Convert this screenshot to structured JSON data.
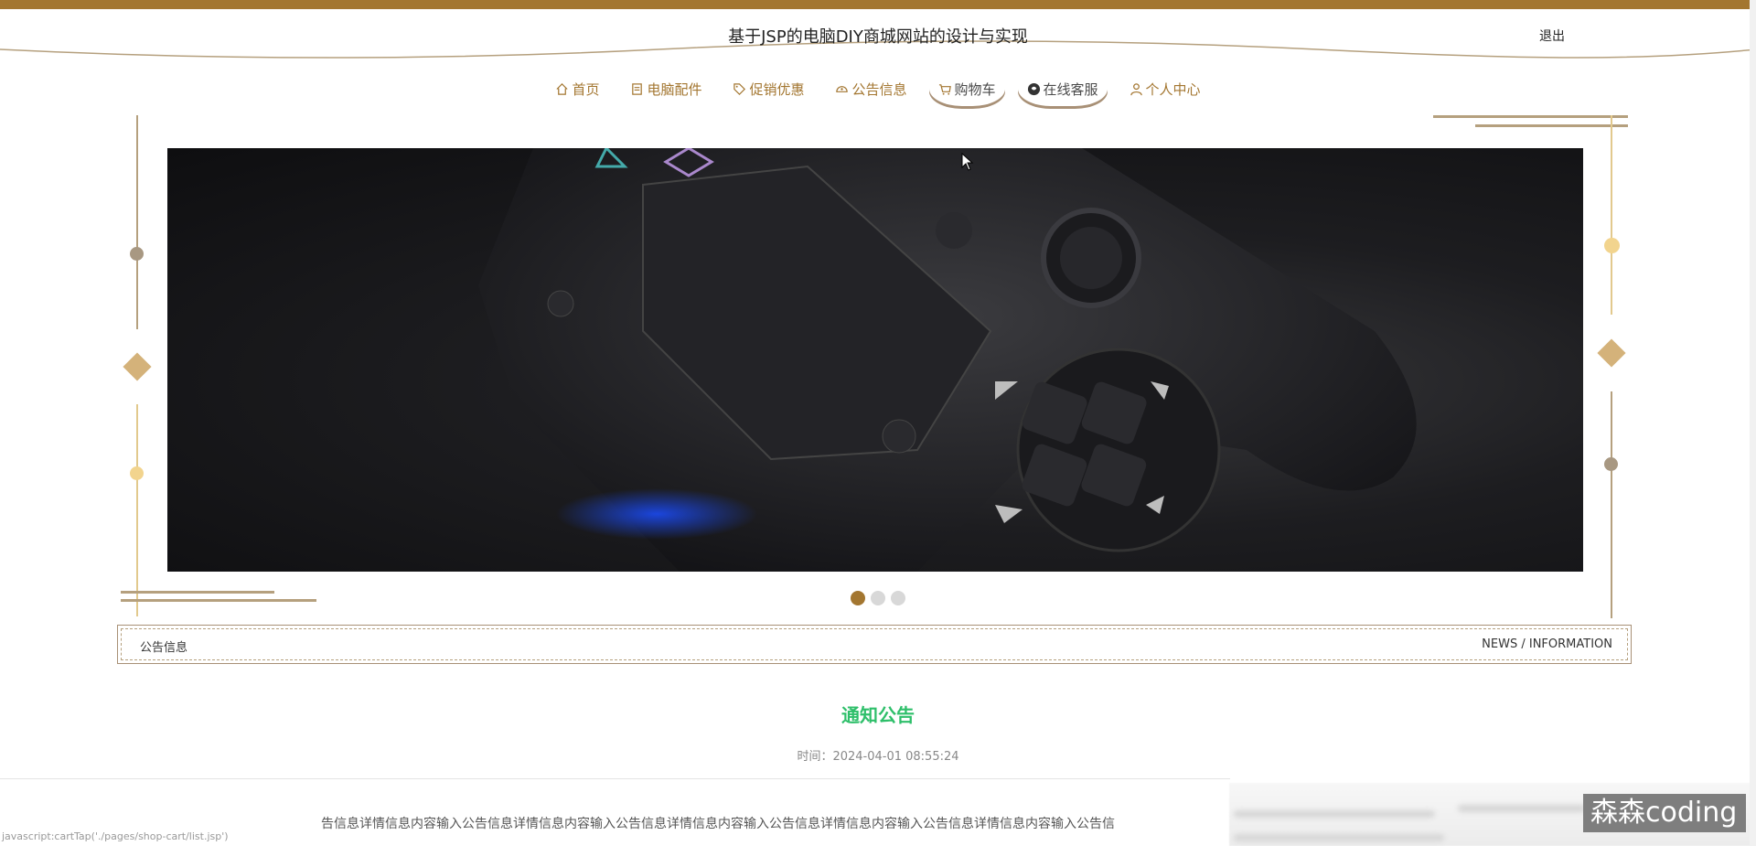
{
  "header": {
    "title": "基于JSP的电脑DIY商城网站的设计与实现",
    "logout_label": "退出"
  },
  "nav": {
    "items": [
      {
        "label": "首页",
        "icon": "home-icon"
      },
      {
        "label": "电脑配件",
        "icon": "product-icon"
      },
      {
        "label": "促销优惠",
        "icon": "tag-icon"
      },
      {
        "label": "公告信息",
        "icon": "notice-icon"
      },
      {
        "label": "购物车",
        "icon": "cart-icon"
      },
      {
        "label": "在线客服",
        "icon": "chat-icon"
      },
      {
        "label": "个人中心",
        "icon": "user-icon"
      }
    ]
  },
  "carousel": {
    "slide_count": 3,
    "active_index": 0,
    "image": "game-controller-photo"
  },
  "section": {
    "title": "公告信息",
    "subtitle": "NEWS / INFORMATION"
  },
  "notice": {
    "title": "通知公告",
    "time": "时间：2024-04-01 08:55:24",
    "content": "告信息详情信息内容输入公告信息详情信息内容输入公告信息详情信息内容输入公告信息详情信息内容输入公告信息详情信息内容输入公告信"
  },
  "status_bar": {
    "url": "javascript:cartTap('./pages/shop-cart/list.jsp')"
  },
  "watermark": "森森coding",
  "colors": {
    "brand": "#a37630",
    "accent_green": "#2ebf6a",
    "deco_gray": "#b5a07e",
    "deco_gold": "#e2c98d"
  }
}
